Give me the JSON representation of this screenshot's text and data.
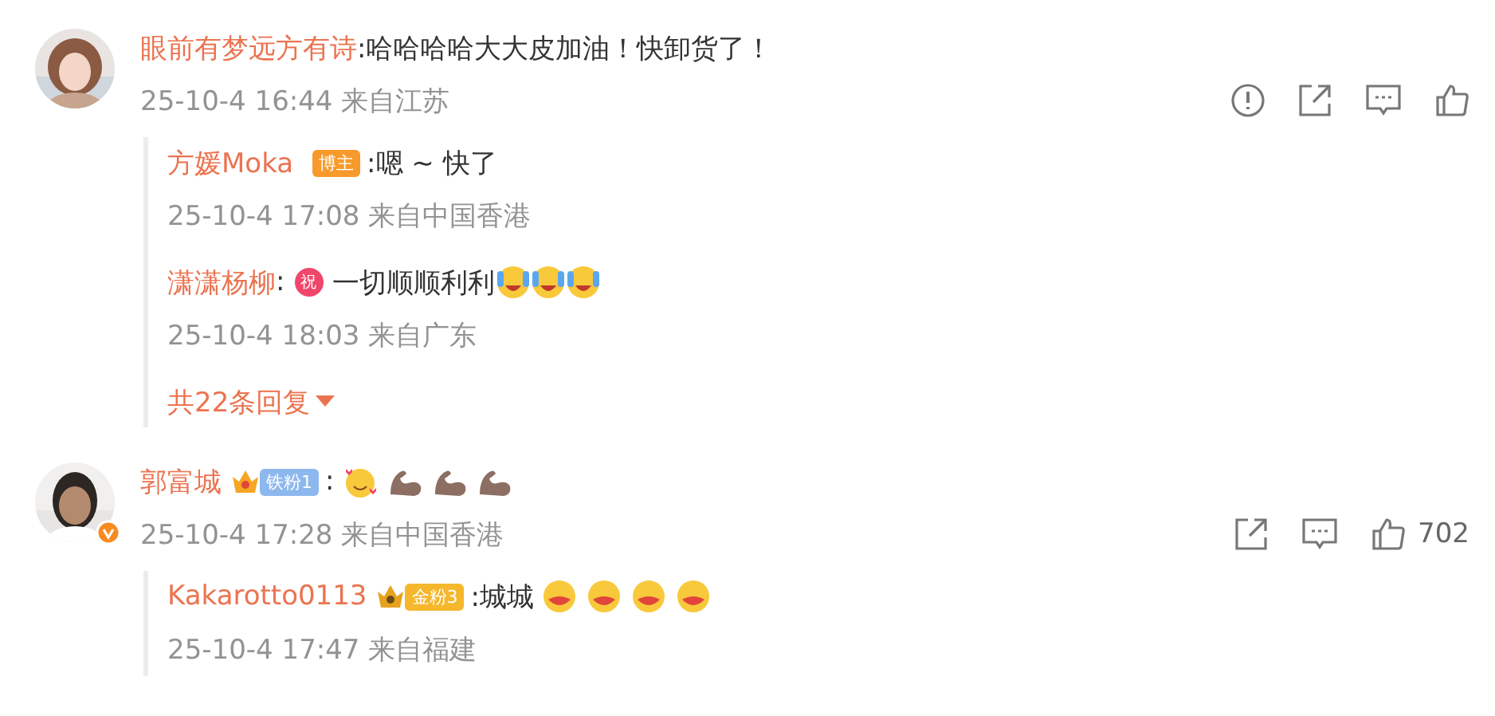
{
  "comments": [
    {
      "user": "眼前有梦远方有诗",
      "verified": false,
      "content": [
        {
          "kind": "text",
          "text": ":哈哈哈哈大大皮加油！快卸货了！"
        }
      ],
      "meta": "25-10-4 16:44 来自江苏",
      "actions": [
        {
          "kind": "report"
        },
        {
          "kind": "share"
        },
        {
          "kind": "reply"
        },
        {
          "kind": "like"
        }
      ],
      "replies": [
        {
          "user": "方媛Moka",
          "badge": {
            "kind": "blogger",
            "label": "博主"
          },
          "content": [
            {
              "kind": "text",
              "text": ":嗯 ~ 快了"
            }
          ],
          "meta": "25-10-4 17:08 来自中国香港"
        },
        {
          "user": "潇潇杨柳",
          "content": [
            {
              "kind": "text",
              "text": ":"
            },
            {
              "kind": "tag",
              "text": "祝"
            },
            {
              "kind": "text",
              "text": "一切顺顺利利"
            },
            {
              "kind": "bawl"
            },
            {
              "kind": "bawl"
            },
            {
              "kind": "bawl"
            }
          ],
          "meta": "25-10-4 18:03 来自广东"
        }
      ],
      "more_replies": "共22条回复"
    },
    {
      "user": "郭富城",
      "verified": true,
      "badge": {
        "kind": "iron",
        "label": "铁粉1"
      },
      "content": [
        {
          "kind": "text",
          "text": ":"
        },
        {
          "kind": "blush"
        },
        {
          "kind": "flex"
        },
        {
          "kind": "flex"
        },
        {
          "kind": "flex"
        }
      ],
      "meta": "25-10-4 17:28 来自中国香港",
      "actions": [
        {
          "kind": "share"
        },
        {
          "kind": "reply"
        },
        {
          "kind": "like"
        }
      ],
      "likes": "702",
      "replies": [
        {
          "user": "Kakarotto0113",
          "badge": {
            "kind": "gold",
            "label": "金粉3"
          },
          "content": [
            {
              "kind": "text",
              "text": ":城城"
            },
            {
              "kind": "hug"
            },
            {
              "kind": "hug"
            },
            {
              "kind": "hug"
            },
            {
              "kind": "hug"
            }
          ],
          "meta": "25-10-4 17:47 来自福建"
        }
      ]
    }
  ]
}
